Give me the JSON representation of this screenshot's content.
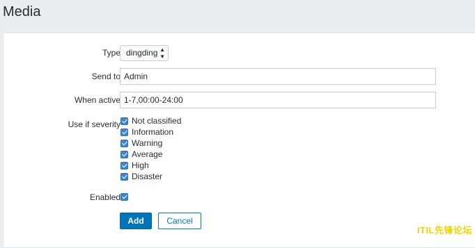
{
  "header": {
    "title": "Media"
  },
  "form": {
    "type": {
      "label": "Type",
      "value": "dingding"
    },
    "send_to": {
      "label": "Send to",
      "value": "Admin"
    },
    "when_active": {
      "label": "When active",
      "value": "1-7,00:00-24:00"
    },
    "severity": {
      "label": "Use if severity",
      "options": [
        {
          "label": "Not classified",
          "checked": true
        },
        {
          "label": "Information",
          "checked": true
        },
        {
          "label": "Warning",
          "checked": true
        },
        {
          "label": "Average",
          "checked": true
        },
        {
          "label": "High",
          "checked": true
        },
        {
          "label": "Disaster",
          "checked": true
        }
      ]
    },
    "enabled": {
      "label": "Enabled",
      "checked": true
    },
    "add_label": "Add",
    "cancel_label": "Cancel"
  },
  "watermark": "ITIL先锋论坛",
  "colors": {
    "accent": "#0275b8",
    "checkbox": "#3d85d1",
    "watermark": "#f0d300"
  }
}
